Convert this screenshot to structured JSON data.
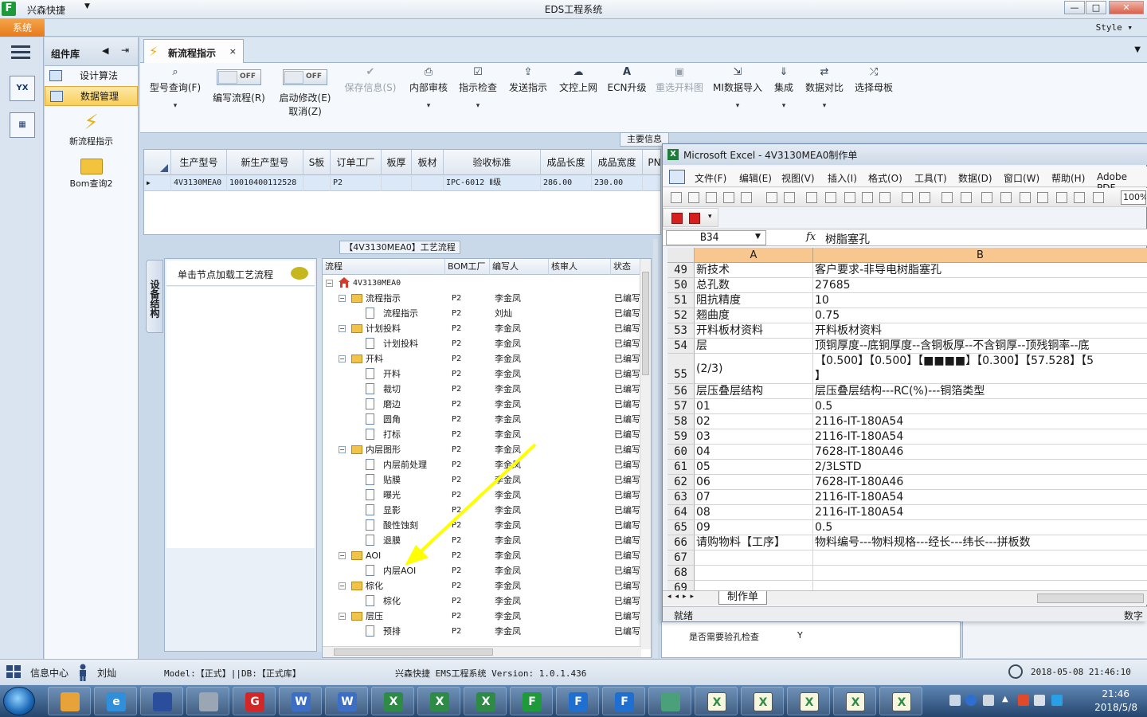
{
  "app": {
    "name": "兴森快捷",
    "window_title": "EDS工程系统",
    "system_tab": "系统",
    "style_label": "Style"
  },
  "window_buttons": [
    "—",
    "□",
    "✕"
  ],
  "component_panel": {
    "title": "组件库",
    "items": [
      {
        "label": "设计算法",
        "active": false
      },
      {
        "label": "数据管理",
        "active": true
      }
    ],
    "tools": [
      {
        "label": "新流程指示",
        "icon": "lightning-icon"
      },
      {
        "label": "Bom查询2",
        "icon": "folder-icon"
      }
    ]
  },
  "doc_tab": {
    "label": "新流程指示",
    "close": "×"
  },
  "toolbar": {
    "buttons": [
      {
        "label": "型号查询(F)",
        "icon": "search-icon",
        "sub": "▾",
        "disabled": false
      },
      {
        "label": "编写流程(R)",
        "toggle": "OFF",
        "disabled": false
      },
      {
        "label": "启动修改(E)",
        "label2": "取消(Z)",
        "toggle": "OFF",
        "disabled": false
      },
      {
        "label": "保存信息(S)",
        "icon": "check-icon",
        "disabled": true
      },
      {
        "label": "内部审核",
        "icon": "print-icon",
        "sub": "▾",
        "disabled": false
      },
      {
        "label": "指示检查",
        "icon": "checkbox-icon",
        "sub": "▾",
        "disabled": false
      },
      {
        "label": "发送指示",
        "icon": "upload-icon",
        "disabled": false
      },
      {
        "label": "文控上网",
        "icon": "cloud-upload-icon",
        "disabled": false
      },
      {
        "label": "ECN升级",
        "icon": "letter-a-icon",
        "disabled": false
      },
      {
        "label": "重选开料图",
        "icon": "image-icon",
        "disabled": true
      },
      {
        "label": "MI数据导入",
        "icon": "import-icon",
        "sub": "▾",
        "disabled": false
      },
      {
        "label": "集成",
        "icon": "download-icon",
        "sub": "▾",
        "disabled": false
      },
      {
        "label": "数据对比",
        "icon": "compare-icon",
        "sub": "▾",
        "disabled": false
      },
      {
        "label": "选择母板",
        "icon": "shuffle-icon",
        "disabled": false
      }
    ]
  },
  "main_info": {
    "caption": "主要信息",
    "columns": [
      "生产型号",
      "新生产型号",
      "S板",
      "订单工厂",
      "板厚",
      "板材",
      "验收标准",
      "成品长度",
      "成品宽度",
      "PN"
    ],
    "row": [
      "4V3130MEA0",
      "10010400112528",
      "",
      "P2",
      "",
      "",
      "IPC-6012 Ⅱ级",
      "286.00",
      "230.00",
      ""
    ]
  },
  "process": {
    "caption": "【4V3130MEA0】工艺流程",
    "side_tab": "设备结构",
    "node_hint": "单击节点加载工艺流程",
    "columns": [
      "流程",
      "BOM工厂",
      "编写人",
      "核审人",
      "状态"
    ],
    "rows": [
      {
        "name": "4V3130MEA0",
        "level": 0,
        "type": "home",
        "expander": "−",
        "bom": "",
        "author": "",
        "reviewer": "",
        "status": ""
      },
      {
        "name": "流程指示",
        "level": 1,
        "type": "folder",
        "expander": "−",
        "bom": "P2",
        "author": "李金凤",
        "reviewer": "",
        "status": "已编写"
      },
      {
        "name": "流程指示",
        "level": 2,
        "type": "doc",
        "bom": "P2",
        "author": "刘灿",
        "reviewer": "",
        "status": "已编写"
      },
      {
        "name": "计划投料",
        "level": 1,
        "type": "folder",
        "expander": "−",
        "bom": "P2",
        "author": "李金凤",
        "reviewer": "",
        "status": "已编写"
      },
      {
        "name": "计划投料",
        "level": 2,
        "type": "doc",
        "bom": "P2",
        "author": "李金凤",
        "reviewer": "",
        "status": "已编写"
      },
      {
        "name": "开料",
        "level": 1,
        "type": "folder",
        "expander": "−",
        "bom": "P2",
        "author": "李金凤",
        "reviewer": "",
        "status": "已编写"
      },
      {
        "name": "开料",
        "level": 2,
        "type": "doc",
        "bom": "P2",
        "author": "李金凤",
        "reviewer": "",
        "status": "已编写"
      },
      {
        "name": "裁切",
        "level": 2,
        "type": "doc",
        "bom": "P2",
        "author": "李金凤",
        "reviewer": "",
        "status": "已编写"
      },
      {
        "name": "磨边",
        "level": 2,
        "type": "doc",
        "bom": "P2",
        "author": "李金凤",
        "reviewer": "",
        "status": "已编写"
      },
      {
        "name": "圆角",
        "level": 2,
        "type": "doc",
        "bom": "P2",
        "author": "李金凤",
        "reviewer": "",
        "status": "已编写"
      },
      {
        "name": "打标",
        "level": 2,
        "type": "doc",
        "bom": "P2",
        "author": "李金凤",
        "reviewer": "",
        "status": "已编写"
      },
      {
        "name": "内层图形",
        "level": 1,
        "type": "folder",
        "expander": "−",
        "bom": "P2",
        "author": "李金凤",
        "reviewer": "",
        "status": "已编写"
      },
      {
        "name": "内层前处理",
        "level": 2,
        "type": "doc",
        "bom": "P2",
        "author": "李金凤",
        "reviewer": "",
        "status": "已编写"
      },
      {
        "name": "贴膜",
        "level": 2,
        "type": "doc",
        "bom": "P2",
        "author": "李金凤",
        "reviewer": "",
        "status": "已编写"
      },
      {
        "name": "曝光",
        "level": 2,
        "type": "doc",
        "bom": "P2",
        "author": "李金凤",
        "reviewer": "",
        "status": "已编写"
      },
      {
        "name": "显影",
        "level": 2,
        "type": "doc",
        "bom": "P2",
        "author": "李金凤",
        "reviewer": "",
        "status": "已编写"
      },
      {
        "name": "酸性蚀刻",
        "level": 2,
        "type": "doc",
        "bom": "P2",
        "author": "李金凤",
        "reviewer": "",
        "status": "已编写"
      },
      {
        "name": "退膜",
        "level": 2,
        "type": "doc",
        "bom": "P2",
        "author": "李金凤",
        "reviewer": "",
        "status": "已编写"
      },
      {
        "name": "AOI",
        "level": 1,
        "type": "folder",
        "expander": "−",
        "bom": "P2",
        "author": "李金凤",
        "reviewer": "",
        "status": "已编写"
      },
      {
        "name": "内层AOI",
        "level": 2,
        "type": "doc",
        "bom": "P2",
        "author": "李金凤",
        "reviewer": "",
        "status": "已编写"
      },
      {
        "name": "棕化",
        "level": 1,
        "type": "folder",
        "expander": "−",
        "bom": "P2",
        "author": "李金凤",
        "reviewer": "",
        "status": "已编写"
      },
      {
        "name": "棕化",
        "level": 2,
        "type": "doc",
        "bom": "P2",
        "author": "李金凤",
        "reviewer": "",
        "status": "已编写"
      },
      {
        "name": "层压",
        "level": 1,
        "type": "folder",
        "expander": "−",
        "bom": "P2",
        "author": "李金凤",
        "reviewer": "",
        "status": "已编写"
      },
      {
        "name": "预排",
        "level": 2,
        "type": "doc",
        "bom": "P2",
        "author": "李金凤",
        "reviewer": "",
        "status": "已编写"
      }
    ]
  },
  "under_right": {
    "label": "是否需要验孔检查",
    "value": "Y"
  },
  "excel": {
    "title": "Microsoft Excel - 4V3130MEA0制作单",
    "menu": [
      "文件(F)",
      "编辑(E)",
      "视图(V)",
      "插入(I)",
      "格式(O)",
      "工具(T)",
      "数据(D)",
      "窗口(W)",
      "帮助(H)",
      "Adobe PDF"
    ],
    "zoom": "100%",
    "name_box": "B34",
    "fx": "fx",
    "formula_value": "树脂塞孔",
    "columns": [
      "A",
      "B"
    ],
    "rows": [
      {
        "n": "49",
        "a": "新技术",
        "b": "客户要求-非导电树脂塞孔"
      },
      {
        "n": "50",
        "a": "总孔数",
        "b": "27685"
      },
      {
        "n": "51",
        "a": "阻抗精度",
        "b": "10"
      },
      {
        "n": "52",
        "a": "翘曲度",
        "b": "0.75"
      },
      {
        "n": "53",
        "a": "开料板材资料",
        "b": "开料板材资料"
      },
      {
        "n": "54",
        "a": "层",
        "b": "顶铜厚度--底铜厚度--含铜板厚--不含铜厚--顶残铜率--底"
      },
      {
        "n": "55",
        "a": "(2/3)",
        "b": "【0.500】【0.500】【■■■■】【0.300】【57.528】【5",
        "b2": "】"
      },
      {
        "n": "56",
        "a": "层压叠层结构",
        "b": "层压叠层结构---RC(%)---铜箔类型"
      },
      {
        "n": "57",
        "a": "01",
        "b": "0.5"
      },
      {
        "n": "58",
        "a": "02",
        "b": "2116-IT-180A54"
      },
      {
        "n": "59",
        "a": "03",
        "b": "2116-IT-180A54"
      },
      {
        "n": "60",
        "a": "04",
        "b": "7628-IT-180A46"
      },
      {
        "n": "61",
        "a": "05",
        "b": "2/3LSTD"
      },
      {
        "n": "62",
        "a": "06",
        "b": "7628-IT-180A46"
      },
      {
        "n": "63",
        "a": "07",
        "b": "2116-IT-180A54"
      },
      {
        "n": "64",
        "a": "08",
        "b": "2116-IT-180A54"
      },
      {
        "n": "65",
        "a": "09",
        "b": "0.5"
      },
      {
        "n": "66",
        "a": "请购物料【工序】",
        "b": "物料编号---物料规格---经长---纬长---拼板数"
      },
      {
        "n": "67",
        "a": "",
        "b": ""
      },
      {
        "n": "68",
        "a": "",
        "b": ""
      },
      {
        "n": "69",
        "a": "",
        "b": ""
      }
    ],
    "sheet_tab": "制作单",
    "status_left": "就绪",
    "status_right": "数字"
  },
  "statusbar": {
    "info_center": "信息中心",
    "user": "刘灿",
    "model": "Model:【正式】||DB:【正式库】",
    "product": "兴森快捷 EMS工程系统 Version: 1.0.1.436",
    "datetime": "2018-05-08 21:46:10"
  },
  "taskbar": {
    "time": "21:46",
    "date": "2018/5/8",
    "apps": [
      "files",
      "ie",
      "save",
      "scanner",
      "red-app",
      "word",
      "word",
      "excel",
      "excel",
      "excel",
      "eds-green",
      "eds-blue",
      "eds-blue",
      "eye-app",
      "excel-window",
      "excel-window",
      "excel-window",
      "excel-window",
      "excel-window"
    ]
  },
  "colors": {
    "accent_orange": "#e77a1b",
    "selection": "#f8cf5a",
    "arrow": "#ffff00",
    "excel_header": "#f7c78f"
  }
}
